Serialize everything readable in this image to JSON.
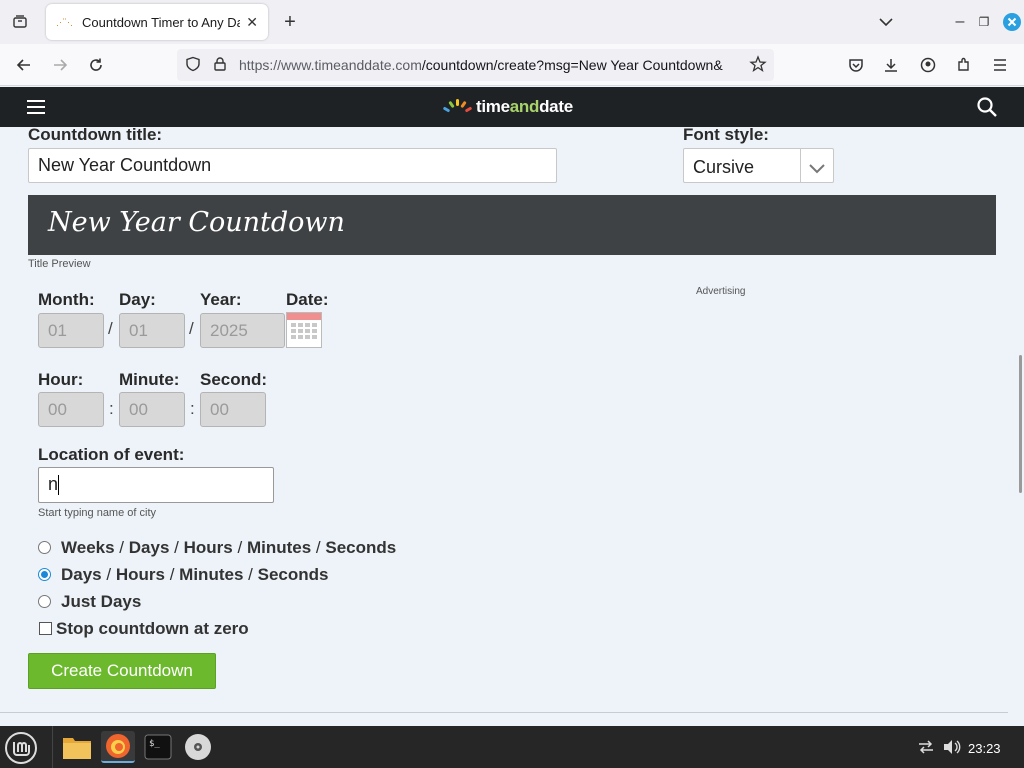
{
  "browser": {
    "tab_title": "Countdown Timer to Any Date",
    "tab_title_shown": "Countdown Timer to Any Da",
    "url_domain": "https://www.timeanddate.com",
    "url_path": "/countdown/create?msg=New Year Countdown&"
  },
  "site": {
    "logo_time": "time",
    "logo_and": "and",
    "logo_date": "date"
  },
  "form": {
    "title_label": "Countdown title:",
    "title_value": "New Year Countdown",
    "font_label": "Font style:",
    "font_value": "Cursive",
    "preview_title": "New Year Countdown",
    "preview_caption": "Title Preview",
    "advertising": "Advertising",
    "month_label": "Month:",
    "day_label": "Day:",
    "year_label": "Year:",
    "date_label": "Date:",
    "month_value": "01",
    "day_value": "01",
    "year_value": "2025",
    "date_sep": "/",
    "hour_label": "Hour:",
    "minute_label": "Minute:",
    "second_label": "Second:",
    "hour_value": "00",
    "minute_value": "00",
    "second_value": "00",
    "time_sep": ":",
    "location_label": "Location of event:",
    "location_value": "n",
    "location_hint": "Start typing name of city",
    "option1": [
      "Weeks",
      "Days",
      "Hours",
      "Minutes",
      "Seconds"
    ],
    "option2": [
      "Days",
      "Hours",
      "Minutes",
      "Seconds"
    ],
    "option3": "Just Days",
    "stop_label": "Stop countdown at zero",
    "slash": "/",
    "submit": "Create Countdown"
  },
  "taskbar": {
    "clock": "23:23"
  },
  "colors": {
    "accent_green": "#6cb92e",
    "header_dark": "#1f2225",
    "radio_blue": "#1a8ad8"
  }
}
